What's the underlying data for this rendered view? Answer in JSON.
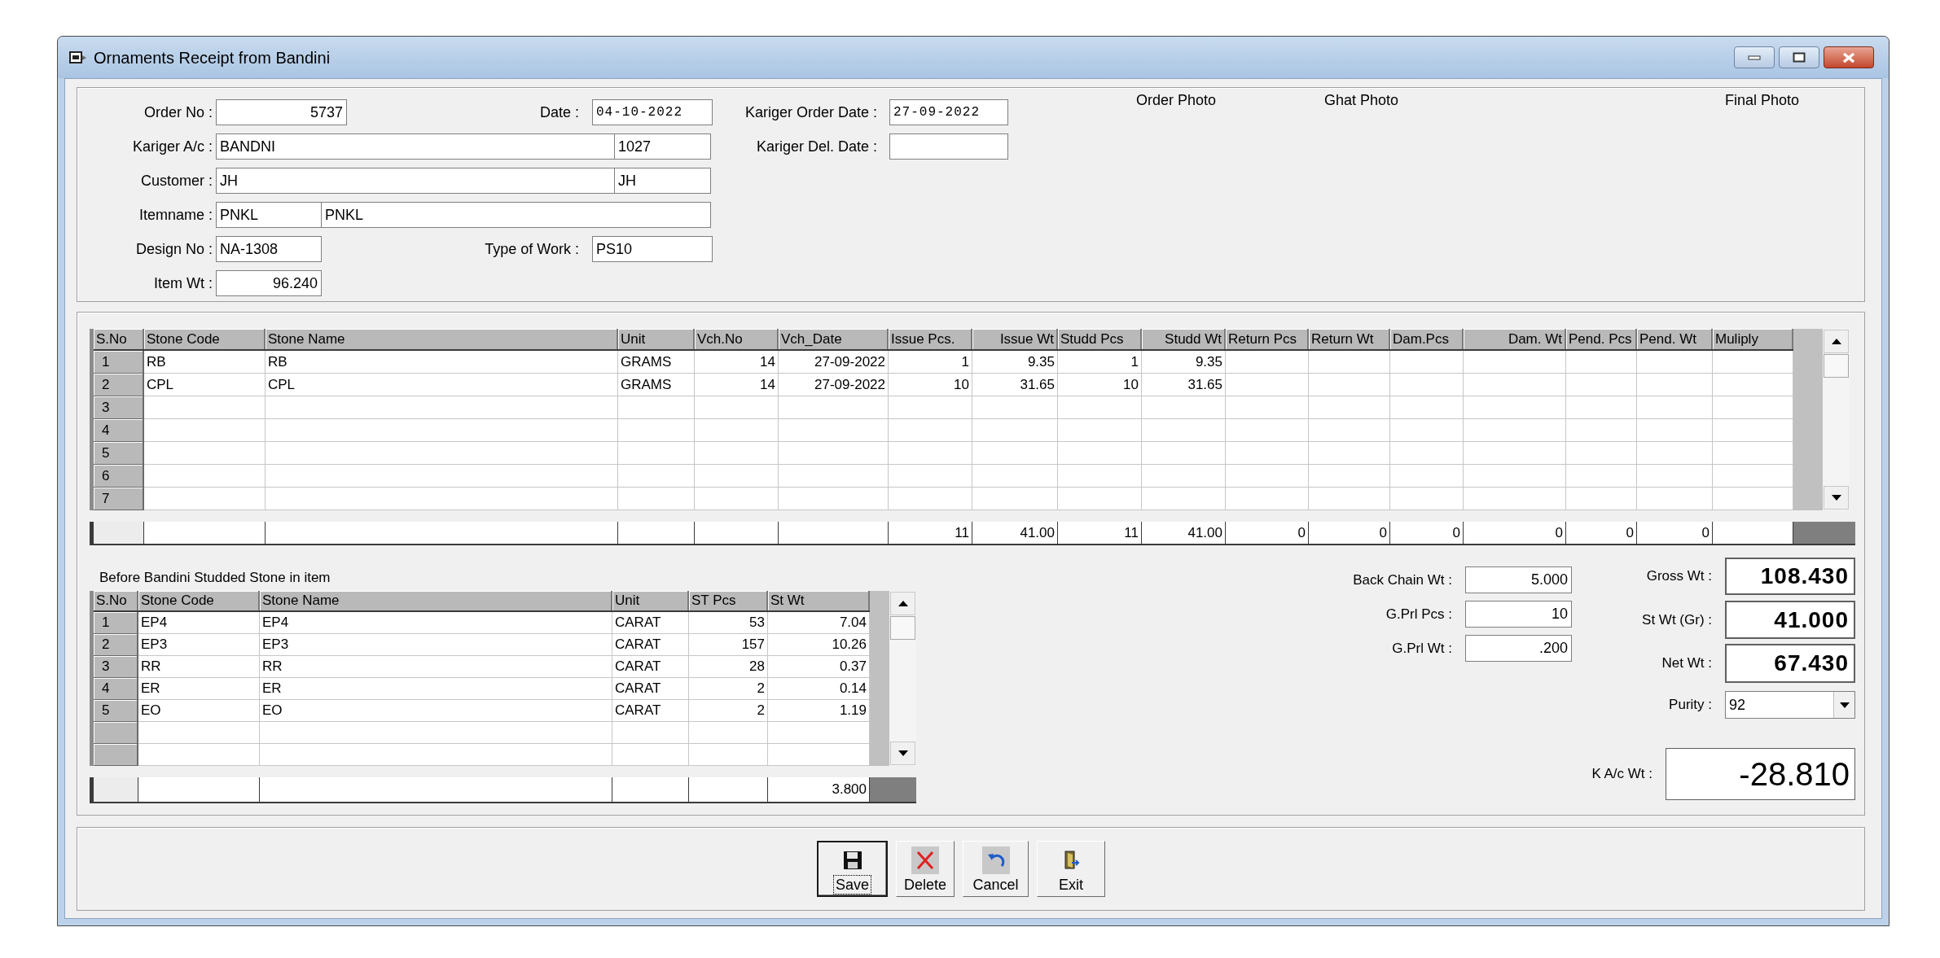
{
  "window": {
    "title": "Ornaments Receipt from Bandini"
  },
  "header": {
    "order_no": {
      "label": "Order No :",
      "value": "5737"
    },
    "date": {
      "label": "Date :",
      "value": "04-10-2022"
    },
    "kariger_order_date": {
      "label": "Kariger Order Date :",
      "value": "27-09-2022"
    },
    "kariger_ac": {
      "label": "Kariger A/c :",
      "name": "BANDNI",
      "code": "1027"
    },
    "kariger_del_date": {
      "label": "Kariger Del. Date :"
    },
    "customer": {
      "label": "Customer :",
      "name": "JH",
      "code": "JH"
    },
    "itemname": {
      "label": "Itemname :",
      "code": "PNKL",
      "name": "PNKL"
    },
    "design_no": {
      "label": "Design No :",
      "value": "NA-1308"
    },
    "type_of_work": {
      "label": "Type of Work :",
      "value": "PS10"
    },
    "item_wt": {
      "label": "Item Wt :",
      "value": "96.240"
    }
  },
  "photos": [
    {
      "label": "Order Photo"
    },
    {
      "label": "Ghat Photo"
    },
    {
      "label": "Final Photo"
    }
  ],
  "stone_grid": {
    "columns": [
      "S.No",
      "Stone Code",
      "Stone Name",
      "Unit",
      "Vch.No",
      "Vch_Date",
      "Issue Pcs.",
      "Issue Wt",
      "Studd Pcs",
      "Studd Wt",
      "Return Pcs",
      "Return Wt",
      "Dam.Pcs",
      "Dam. Wt",
      "Pend. Pcs",
      "Pend. Wt",
      "Muliply"
    ],
    "rows": [
      {
        "cells": [
          "1",
          "RB",
          "RB",
          "GRAMS",
          "14",
          "27-09-2022",
          "1",
          "9.35",
          "1",
          "9.35"
        ]
      },
      {
        "cells": [
          "2",
          "CPL",
          "CPL",
          "GRAMS",
          "14",
          "27-09-2022",
          "10",
          "31.65",
          "10",
          "31.65"
        ]
      },
      {
        "cells": [
          "3"
        ]
      },
      {
        "cells": [
          "4"
        ]
      },
      {
        "cells": [
          "5"
        ]
      },
      {
        "cells": [
          "6"
        ]
      },
      {
        "cells": [
          "7"
        ]
      }
    ],
    "totals": [
      "11",
      "41.00",
      "11",
      "41.00",
      "0",
      "0",
      "0",
      "0",
      "0",
      "0"
    ]
  },
  "before_grid": {
    "title": "Before Bandini Studded Stone in item",
    "columns": [
      "S.No",
      "Stone Code",
      "Stone Name",
      "Unit",
      "ST Pcs",
      "St Wt"
    ],
    "rows": [
      {
        "cells": [
          "1",
          "EP4",
          "EP4",
          "CARAT",
          "53",
          "7.04"
        ]
      },
      {
        "cells": [
          "2",
          "EP3",
          "EP3",
          "CARAT",
          "157",
          "10.26"
        ]
      },
      {
        "cells": [
          "3",
          "RR",
          "RR",
          "CARAT",
          "28",
          "0.37"
        ]
      },
      {
        "cells": [
          "4",
          "ER",
          "ER",
          "CARAT",
          "2",
          "0.14"
        ]
      },
      {
        "cells": [
          "5",
          "EO",
          "EO",
          "CARAT",
          "2",
          "1.19"
        ]
      }
    ],
    "totals": [
      "3.800"
    ]
  },
  "extras": [
    {
      "label": "Back Chain Wt :",
      "value": "5.000"
    },
    {
      "label": "G.Prl Pcs :",
      "value": "10"
    },
    {
      "label": "G.Prl Wt :",
      "value": ".200"
    }
  ],
  "weights": {
    "gross_wt": {
      "label": "Gross Wt :",
      "value": "108.430"
    },
    "st_wt": {
      "label": "St Wt (Gr) :",
      "value": "41.000"
    },
    "net_wt": {
      "label": "Net Wt :",
      "value": "67.430"
    },
    "purity": {
      "label": "Purity :",
      "value": "92"
    },
    "ka_wt": {
      "label": "K A/c Wt :",
      "value": "-28.810"
    }
  },
  "buttons": [
    {
      "kind": "save",
      "label": "Save",
      "focused": true
    },
    {
      "kind": "delete",
      "label": "Delete",
      "focused": false
    },
    {
      "kind": "cancel",
      "label": "Cancel",
      "focused": false
    },
    {
      "kind": "exit",
      "label": "Exit",
      "focused": false
    }
  ]
}
